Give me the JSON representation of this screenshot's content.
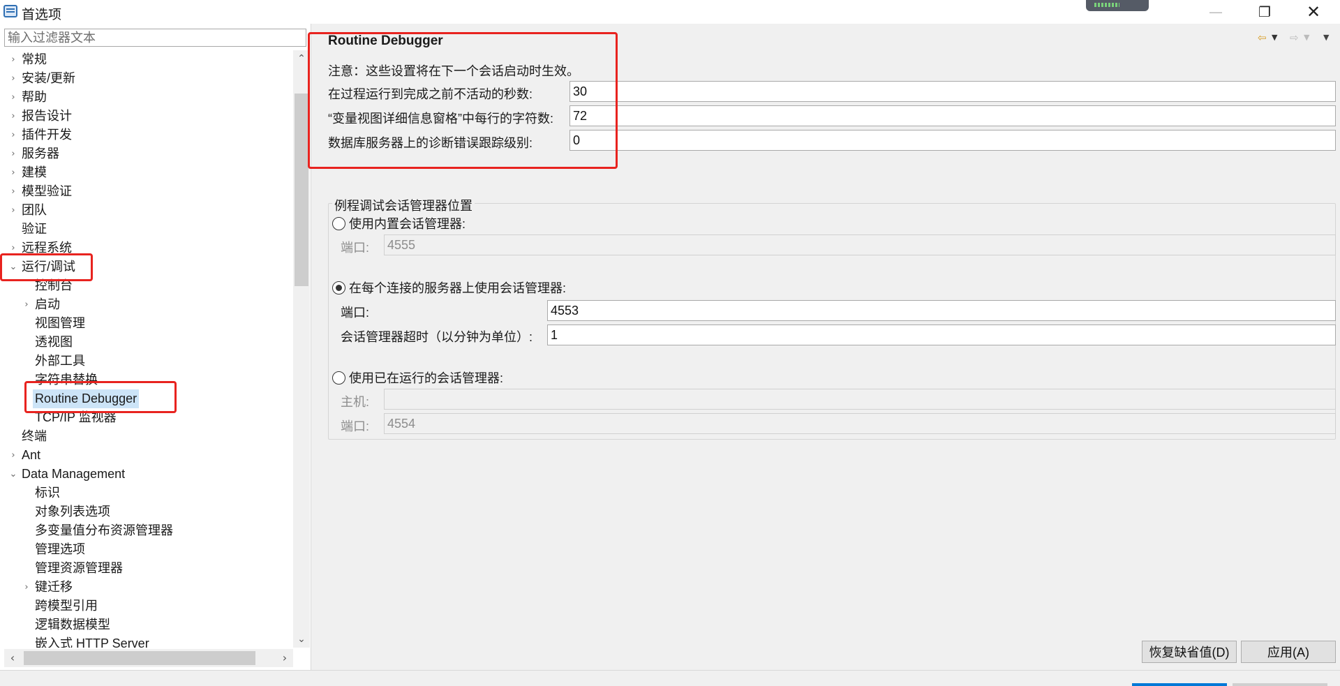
{
  "window": {
    "title": "首选项",
    "minimize_glyph": "—",
    "maximize_glyph": "❐",
    "close_glyph": "✕"
  },
  "filter": {
    "placeholder": "输入过滤器文本"
  },
  "tree": [
    {
      "label": "常规",
      "level": 0,
      "arrow": "›"
    },
    {
      "label": "安装/更新",
      "level": 0,
      "arrow": "›"
    },
    {
      "label": "帮助",
      "level": 0,
      "arrow": "›"
    },
    {
      "label": "报告设计",
      "level": 0,
      "arrow": "›"
    },
    {
      "label": "插件开发",
      "level": 0,
      "arrow": "›"
    },
    {
      "label": "服务器",
      "level": 0,
      "arrow": "›"
    },
    {
      "label": "建模",
      "level": 0,
      "arrow": "›"
    },
    {
      "label": "模型验证",
      "level": 0,
      "arrow": "›"
    },
    {
      "label": "团队",
      "level": 0,
      "arrow": "›"
    },
    {
      "label": "验证",
      "level": 0,
      "arrow": ""
    },
    {
      "label": "远程系统",
      "level": 0,
      "arrow": "›"
    },
    {
      "label": "运行/调试",
      "level": 0,
      "arrow": "⌄"
    },
    {
      "label": "控制台",
      "level": 1,
      "arrow": ""
    },
    {
      "label": "启动",
      "level": 1,
      "arrow": "›"
    },
    {
      "label": "视图管理",
      "level": 1,
      "arrow": ""
    },
    {
      "label": "透视图",
      "level": 1,
      "arrow": ""
    },
    {
      "label": "外部工具",
      "level": 1,
      "arrow": ""
    },
    {
      "label": "字符串替换",
      "level": 1,
      "arrow": ""
    },
    {
      "label": "Routine Debugger",
      "level": 1,
      "arrow": "",
      "selected": true
    },
    {
      "label": "TCP/IP 监视器",
      "level": 1,
      "arrow": ""
    },
    {
      "label": "终端",
      "level": 0,
      "arrow": ""
    },
    {
      "label": "Ant",
      "level": 0,
      "arrow": "›"
    },
    {
      "label": "Data Management",
      "level": 0,
      "arrow": "⌄"
    },
    {
      "label": "标识",
      "level": 1,
      "arrow": ""
    },
    {
      "label": "对象列表选项",
      "level": 1,
      "arrow": ""
    },
    {
      "label": "多变量值分布资源管理器",
      "level": 1,
      "arrow": ""
    },
    {
      "label": "管理选项",
      "level": 1,
      "arrow": ""
    },
    {
      "label": "管理资源管理器",
      "level": 1,
      "arrow": ""
    },
    {
      "label": "键迁移",
      "level": 1,
      "arrow": "›"
    },
    {
      "label": "跨模型引用",
      "level": 1,
      "arrow": ""
    },
    {
      "label": "逻辑数据模型",
      "level": 1,
      "arrow": ""
    },
    {
      "label": "嵌入式 HTTP Server",
      "level": 1,
      "arrow": ""
    }
  ],
  "page": {
    "title": "Routine Debugger",
    "note": "注意：这些设置将在下一个会话启动时生效。",
    "fields": [
      {
        "label": "在过程运行到完成之前不活动的秒数:",
        "value": "30"
      },
      {
        "label": "“变量视图详细信息窗格”中每行的字符数:",
        "value": "72"
      },
      {
        "label": "数据库服务器上的诊断错误跟踪级别:",
        "value": "0"
      }
    ],
    "group": {
      "title": "例程调试会话管理器位置",
      "option_builtin": "使用内置会话管理器:",
      "builtin_port_label": "端口:",
      "builtin_port_value": "4555",
      "option_each_server": "在每个连接的服务器上使用会话管理器:",
      "each_port_label": "端口:",
      "each_port_value": "4553",
      "each_timeout_label": "会话管理器超时（以分钟为单位）:",
      "each_timeout_value": "1",
      "option_running": "使用已在运行的会话管理器:",
      "running_host_label": "主机:",
      "running_host_value": "",
      "running_port_label": "端口:",
      "running_port_value": "4554",
      "selected_option": "each_server"
    },
    "buttons": {
      "restore_defaults": "恢复缺省值(D)",
      "apply": "应用(A)"
    }
  },
  "nav": {
    "back_icon": "⇦",
    "forward_icon": "⇨",
    "dropdown_glyph": "▼"
  },
  "colors": {
    "highlight_box": "#e8231f",
    "selection": "#cce4f7",
    "primary_accent": "#0078d7"
  }
}
